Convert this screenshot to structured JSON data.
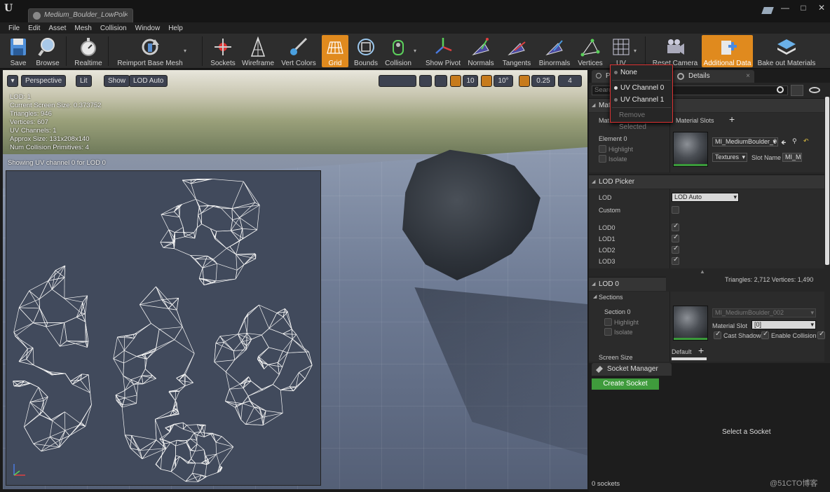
{
  "window": {
    "tab_title": "Medium_Boulder_LowPoli",
    "tab_close": "×",
    "minimize": "—",
    "maximize": "□",
    "close": "✕"
  },
  "menu": [
    "File",
    "Edit",
    "Asset",
    "Mesh",
    "Collision",
    "Window",
    "Help"
  ],
  "toolbar": {
    "save": "Save",
    "browse": "Browse",
    "realtime": "Realtime",
    "reimport": "Reimport Base Mesh",
    "sockets": "Sockets",
    "wireframe": "Wireframe",
    "vert_colors": "Vert Colors",
    "grid": "Grid",
    "bounds": "Bounds",
    "collision": "Collision",
    "show_pivot": "Show Pivot",
    "normals": "Normals",
    "tangents": "Tangents",
    "binormals": "Binormals",
    "vertices": "Vertices",
    "uv": "UV",
    "reset_camera": "Reset Camera",
    "additional_data": "Additional Data",
    "bake_out": "Bake out Materials"
  },
  "viewport": {
    "dropdown": "▾",
    "perspective": "Perspective",
    "lit": "Lit",
    "show": "Show",
    "lod": "LOD Auto",
    "grid_snap": "10",
    "rot_snap": "10°",
    "scale_snap": "0.25",
    "cam_speed": "4",
    "stats": [
      "LOD:  1",
      "Current Screen Size:  0.373752",
      "Triangles:  946",
      "Vertices:  607",
      "UV Channels:  1",
      "Approx Size: 131x208x140",
      "Num Collision Primitives:  4"
    ],
    "uv_caption": "Showing UV channel 0 for LOD 0"
  },
  "uv_menu": {
    "none": "None",
    "channel0": "UV Channel 0",
    "channel1": "UV Channel 1",
    "remove": "Remove Selected"
  },
  "details": {
    "tab_left": "P",
    "tab_details": "Details",
    "search_placeholder": "Search",
    "materials_head": "Mat",
    "mat_label": "Mat",
    "material_slots": "Material Slots",
    "element0": "Element 0",
    "highlight": "Highlight",
    "isolate": "Isolate",
    "material_name": "MI_MediumBoulder_0",
    "textures": "Textures",
    "slot_name_label": "Slot Name",
    "slot_name_value": "MI_M",
    "lod_picker_head": "LOD Picker",
    "lod_label": "LOD",
    "lod_value": "LOD Auto",
    "custom": "Custom",
    "lod_rows": [
      "LOD0",
      "LOD1",
      "LOD2",
      "LOD3"
    ],
    "totals": "Triangles: 2,712   Vertices: 1,490",
    "lod0_head": "LOD 0",
    "sections_head": "Sections",
    "section0": "Section 0",
    "section_highlight": "Highlight",
    "section_isolate": "Isolate",
    "section_material": "MI_MediumBoulder_002",
    "material_slot_label": "Material Slot",
    "material_slot_value": "[0] MI_MediumBoulde",
    "cast_shadow": "Cast Shadow",
    "enable_collision": "Enable Collision",
    "screen_size": "Screen Size",
    "default": "Default"
  },
  "socket_manager": {
    "title": "Socket Manager",
    "create": "Create Socket",
    "select": "Select a Socket",
    "count": "0 sockets"
  },
  "watermark": "@51CTO博客",
  "colors": {
    "accent": "#e08a1e",
    "create_green": "#3f9b3c",
    "dropdown_border": "#dd3333"
  }
}
